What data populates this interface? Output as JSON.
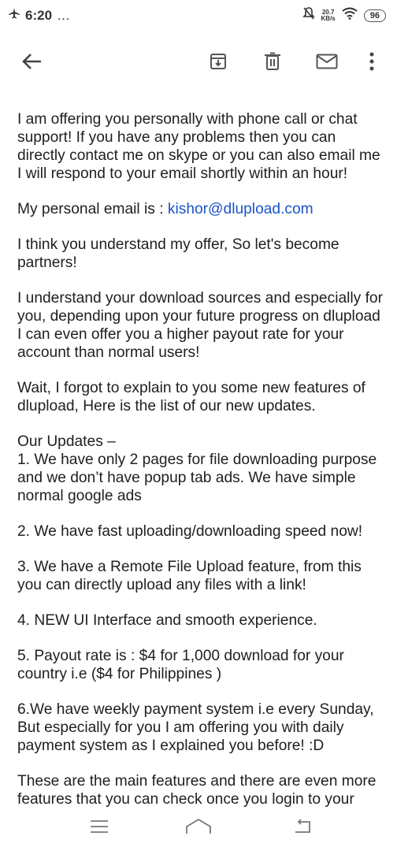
{
  "status": {
    "time": "6:20",
    "dots": "…",
    "net_speed_value": "20.7",
    "net_speed_unit": "KB/s",
    "battery": "96"
  },
  "email": {
    "p1": "I am offering you personally with phone call or chat support! If you have any problems then you can directly contact me on skype or you can also email me I will respond to your email shortly within an hour!",
    "email_label": "My personal email is : ",
    "email_address": "kishor@dlupload.com",
    "p3": "I think you understand my offer, So let's become partners!",
    "p4": "I understand your download sources and especially for you, depending upon your future progress on dlupload I can even offer you a higher payout rate for your account than normal users!",
    "p5": "Wait, I forgot to explain to you some new features of dlupload, Here is the list of our new updates.",
    "updates_heading": "Our Updates –",
    "u1": "1.  We have only 2 pages for file downloading purpose and we don’t have popup tab ads. We have simple normal google ads",
    "u2": "2.  We have fast uploading/downloading speed now!",
    "u3": "3.  We have a Remote File Upload feature, from this you can directly upload any files with a link!",
    "u4": "4. NEW UI Interface and smooth experience.",
    "u5": "5. Payout rate is : $4 for 1,000 download for your country i.e ($4 for Philippines )",
    "u6": "6.We have weekly payment system i.e every Sunday, But especially for you I am offering you with daily payment system as I explained you before! :D",
    "p_last": "These are the main features and there are even more features that you can check once you login to your"
  },
  "icons": {
    "back": "back-arrow-icon",
    "archive": "archive-icon",
    "delete": "trash-icon",
    "mail": "mail-icon",
    "more": "more-vert-icon"
  },
  "colors": {
    "link": "#1a55c8",
    "icon": "#555555"
  }
}
